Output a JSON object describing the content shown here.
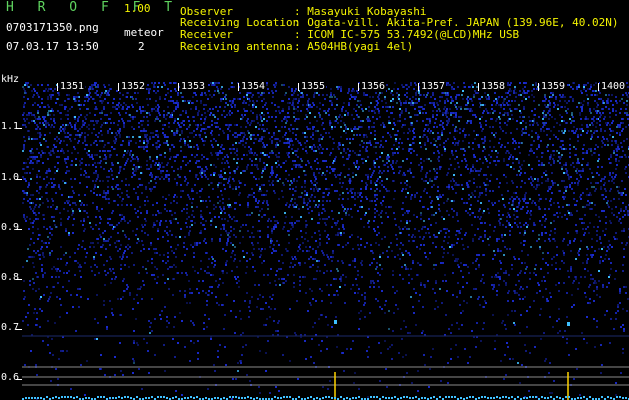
{
  "app": {
    "name": "H R O F F T",
    "version": "1.00"
  },
  "file": {
    "name": "0703171350.png",
    "datetime": "07.03.17 13:50"
  },
  "meteor": {
    "label": "meteor",
    "count": "2"
  },
  "station": {
    "observer_label": "Observer",
    "observer_value": ": Masayuki Kobayashi",
    "location_label": "Receiving Location",
    "location_value": ": Ogata-vill. Akita-Pref. JAPAN (139.96E, 40.02N)",
    "receiver_label": "Receiver",
    "receiver_value": ": ICOM IC-575 53.7492(@LCD)MHz USB",
    "antenna_label": "Receiving antenna",
    "antenna_value": ": A504HB(yagi 4el)"
  },
  "y_axis": {
    "unit": "kHz",
    "ticks": [
      "1.1",
      "1.0",
      "0.9",
      "0.8",
      "0.7",
      "0.6"
    ]
  },
  "x_axis": {
    "ticks": [
      "1351",
      "1352",
      "1353",
      "1354",
      "1355",
      "1356",
      "1357",
      "1358",
      "1359",
      "1400"
    ]
  },
  "colors": {
    "background": "#000000",
    "noise": "#1a2bd0",
    "bright": "#3fc0ff",
    "trail": "#ffd200",
    "title": "#5fd35f",
    "version": "#f4f400"
  }
}
